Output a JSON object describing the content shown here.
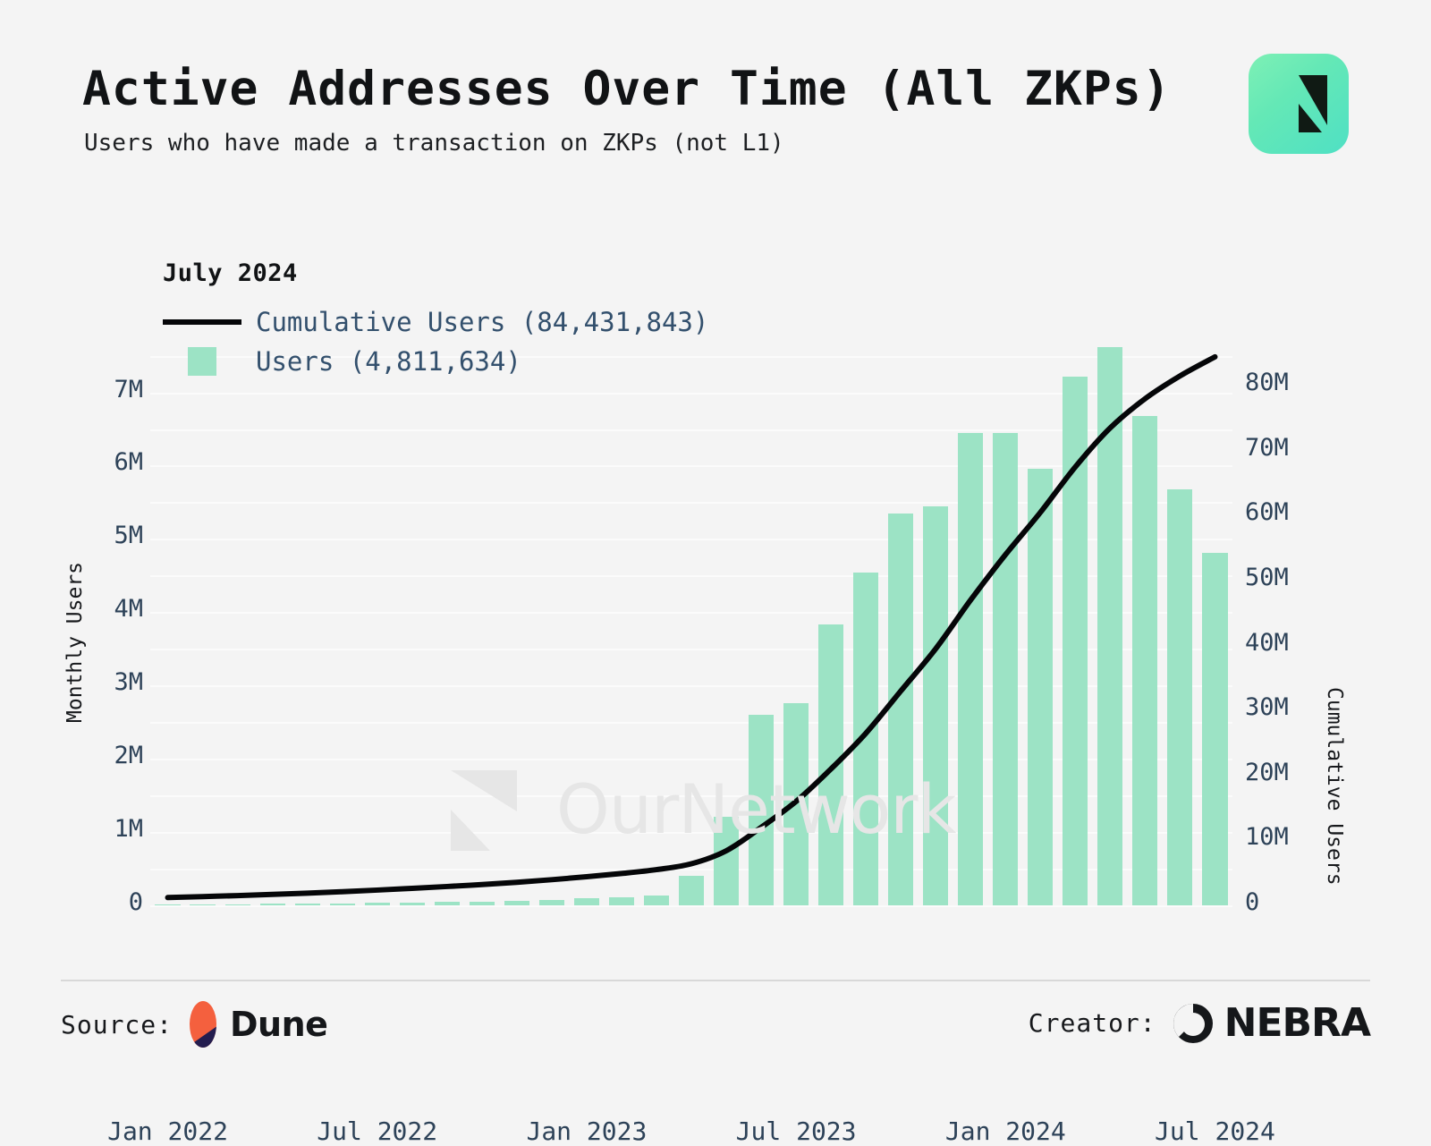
{
  "header": {
    "title": "Active Addresses Over Time (All ZKPs)",
    "subtitle": "Users who have made a transaction on ZKPs (not L1)",
    "logo_icon": "ournetwork-logo-icon"
  },
  "legend": {
    "period": "July 2024",
    "line_label": "Cumulative Users (84,431,843)",
    "bar_label": "Users (4,811,634)",
    "line_color": "#050608",
    "bar_color": "#9ce3c5"
  },
  "watermark": {
    "text": "OurNetwork"
  },
  "footer": {
    "source_label": "Source:",
    "source_name": "Dune",
    "source_icon": "dune-logo-icon",
    "creator_label": "Creator:",
    "creator_name": "NEBRA",
    "creator_icon": "nebra-logo-icon"
  },
  "chart_data": {
    "type": "bar",
    "title": "Active Addresses Over Time (All ZKPs)",
    "subtitle": "Users who have made a transaction on ZKPs (not L1)",
    "xlabel": "",
    "ylabel": "Monthly Users",
    "y2label": "Cumulative Users",
    "grid": true,
    "legend_position": "top-left",
    "ylim": [
      0,
      7800000
    ],
    "y2lim": [
      0,
      88000000
    ],
    "yticks": [
      "0",
      "1M",
      "2M",
      "3M",
      "4M",
      "5M",
      "6M",
      "7M"
    ],
    "ytick_values": [
      0,
      1000000,
      2000000,
      3000000,
      4000000,
      5000000,
      6000000,
      7000000
    ],
    "y2ticks": [
      "0",
      "10M",
      "20M",
      "30M",
      "40M",
      "50M",
      "60M",
      "70M",
      "80M"
    ],
    "y2tick_values": [
      0,
      10000000,
      20000000,
      30000000,
      40000000,
      50000000,
      60000000,
      70000000,
      80000000
    ],
    "xticks": [
      "Jan 2022",
      "Jul 2022",
      "Jan 2023",
      "Jul 2023",
      "Jan 2024",
      "Jul 2024"
    ],
    "xtick_indices": [
      0,
      6,
      12,
      18,
      24,
      30
    ],
    "categories": [
      "Jan 2022",
      "Feb 2022",
      "Mar 2022",
      "Apr 2022",
      "May 2022",
      "Jun 2022",
      "Jul 2022",
      "Aug 2022",
      "Sep 2022",
      "Oct 2022",
      "Nov 2022",
      "Dec 2022",
      "Jan 2023",
      "Feb 2023",
      "Mar 2023",
      "Apr 2023",
      "May 2023",
      "Jun 2023",
      "Jul 2023",
      "Aug 2023",
      "Sep 2023",
      "Oct 2023",
      "Nov 2023",
      "Dec 2023",
      "Jan 2024",
      "Feb 2024",
      "Mar 2024",
      "Apr 2024",
      "May 2024",
      "Jun 2024",
      "Jul 2024"
    ],
    "series": [
      {
        "name": "Users",
        "type": "bar",
        "axis": "left",
        "color": "#9ce3c5",
        "values": [
          12000,
          14000,
          16000,
          20000,
          24000,
          28000,
          34000,
          42000,
          46000,
          52000,
          60000,
          70000,
          95000,
          110000,
          130000,
          400000,
          1210000,
          2600000,
          2760000,
          3830000,
          4540000,
          5350000,
          5440000,
          6450000,
          6450000,
          5960000,
          7210000,
          7620000,
          6680000,
          5680000,
          4811634
        ]
      },
      {
        "name": "Cumulative Users",
        "type": "line",
        "axis": "right",
        "color": "#050608",
        "values": [
          1200000,
          1350000,
          1500000,
          1680000,
          1880000,
          2100000,
          2350000,
          2620000,
          2900000,
          3200000,
          3550000,
          3950000,
          4400000,
          4900000,
          5500000,
          6400000,
          8400000,
          12000000,
          16000000,
          21000000,
          26500000,
          33000000,
          39500000,
          47000000,
          54000000,
          60500000,
          67500000,
          73500000,
          78000000,
          81500000,
          84431843
        ]
      }
    ]
  }
}
